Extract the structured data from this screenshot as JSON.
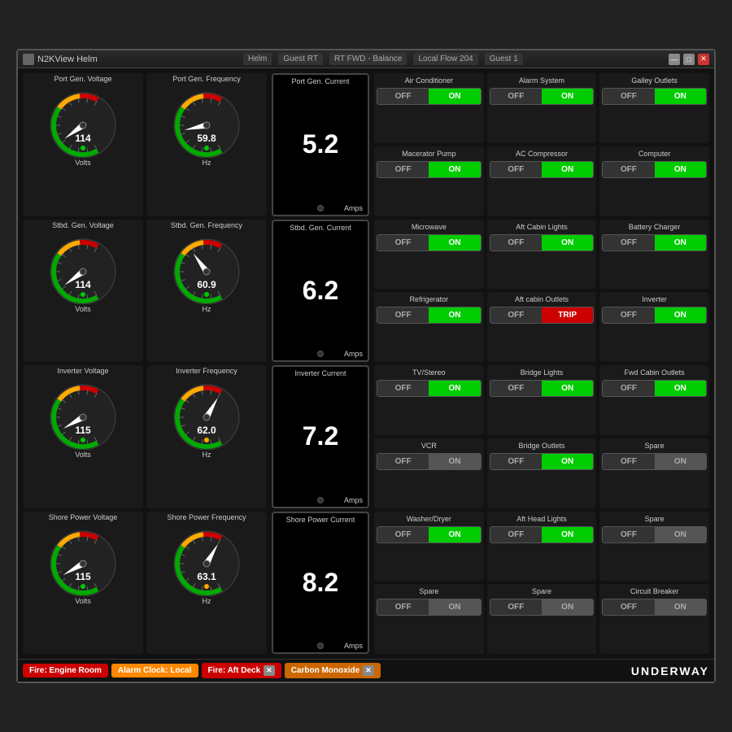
{
  "window": {
    "title": "N2KView Helm",
    "tabs": [
      "Helm",
      "Guest RT",
      "RT FWD - Balance",
      "Local Flow 204",
      "Guest 1"
    ],
    "status": "UNDERWAY"
  },
  "gauges": [
    {
      "label": "Port Gen. Voltage",
      "value": "114",
      "unit": "Volts",
      "min": 100,
      "max": 140,
      "needle": 114,
      "arc_color": "#00cc00"
    },
    {
      "label": "Port Gen. Frequency",
      "value": "59.8",
      "unit": "Hz",
      "min": 58,
      "max": 62,
      "needle": 59.8,
      "arc_color": "#00cc00"
    },
    {
      "label": "Stbd. Gen. Voltage",
      "value": "114",
      "unit": "Volts",
      "min": 100,
      "max": 140,
      "needle": 114,
      "arc_color": "#00cc00"
    },
    {
      "label": "Stbd. Gen. Frequency",
      "value": "60.9",
      "unit": "Hz",
      "min": 58,
      "max": 62,
      "needle": 60.9,
      "arc_color": "#00cc00"
    },
    {
      "label": "Inverter Voltage",
      "value": "115",
      "unit": "Volts",
      "min": 100,
      "max": 140,
      "needle": 115,
      "arc_color": "#00cc00"
    },
    {
      "label": "Inverter Frequency",
      "value": "62.0",
      "unit": "Hz",
      "min": 58,
      "max": 62,
      "needle": 62.0,
      "arc_color": "#ff8800"
    },
    {
      "label": "Shore Power Voltage",
      "value": "115",
      "unit": "Volts",
      "min": 100,
      "max": 140,
      "needle": 115,
      "arc_color": "#00cc00"
    },
    {
      "label": "Shore Power Frequency",
      "value": "63.1",
      "unit": "Hz",
      "min": 58,
      "max": 62,
      "needle": 63.1,
      "arc_color": "#ff8800"
    }
  ],
  "currents": [
    {
      "label": "Port Gen. Current",
      "value": "5.2",
      "unit": "Amps"
    },
    {
      "label": "Stbd. Gen. Current",
      "value": "6.2",
      "unit": "Amps"
    },
    {
      "label": "Inverter Current",
      "value": "7.2",
      "unit": "Amps"
    },
    {
      "label": "Shore Power Current",
      "value": "8.2",
      "unit": "Amps"
    }
  ],
  "switches": [
    {
      "label": "Air Conditioner",
      "state": "on"
    },
    {
      "label": "Alarm System",
      "state": "on"
    },
    {
      "label": "Galley Outlets",
      "state": "on"
    },
    {
      "label": "Macerator Pump",
      "state": "on"
    },
    {
      "label": "AC Compressor",
      "state": "on"
    },
    {
      "label": "Computer",
      "state": "on"
    },
    {
      "label": "Microwave",
      "state": "on"
    },
    {
      "label": "Aft Cabin Lights",
      "state": "on"
    },
    {
      "label": "Battery Charger",
      "state": "on"
    },
    {
      "label": "Refrigerator",
      "state": "on"
    },
    {
      "label": "Aft cabin Outlets",
      "state": "trip"
    },
    {
      "label": "Inverter",
      "state": "on"
    },
    {
      "label": "TV/Stereo",
      "state": "on"
    },
    {
      "label": "Bridge Lights",
      "state": "on"
    },
    {
      "label": "Fwd Cabin Outlets",
      "state": "on"
    },
    {
      "label": "VCR",
      "state": "off"
    },
    {
      "label": "Bridge Outlets",
      "state": "on"
    },
    {
      "label": "Spare",
      "state": "off"
    },
    {
      "label": "Washer/Dryer",
      "state": "on"
    },
    {
      "label": "Aft Head Lights",
      "state": "on"
    },
    {
      "label": "Spare",
      "state": "off"
    },
    {
      "label": "Spare",
      "state": "off"
    },
    {
      "label": "Spare",
      "state": "off"
    },
    {
      "label": "Circuit Breaker",
      "state": "off"
    }
  ],
  "alarms": [
    {
      "label": "Fire: Engine Room",
      "type": "fire",
      "closeable": false
    },
    {
      "label": "Alarm Clock: Local",
      "type": "clock",
      "closeable": false
    },
    {
      "label": "Fire: Aft Deck",
      "type": "fire2",
      "closeable": true
    },
    {
      "label": "Carbon Monoxide",
      "type": "carbon",
      "closeable": true
    }
  ],
  "labels": {
    "off": "OFF",
    "on": "ON",
    "trip": "TRIP"
  }
}
